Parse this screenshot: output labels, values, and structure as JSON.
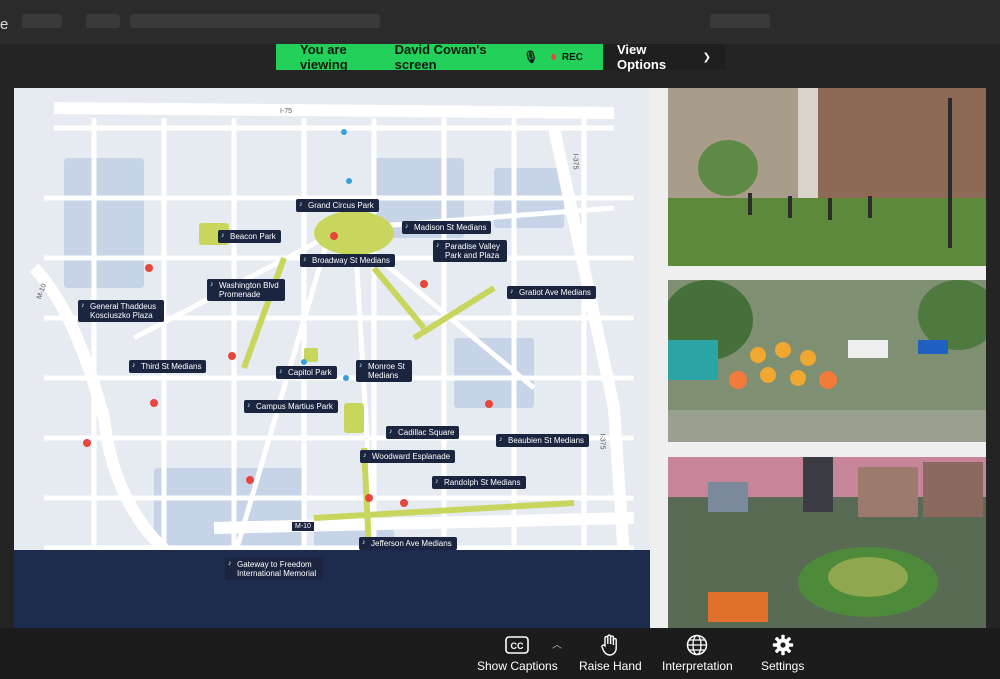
{
  "share_banner": {
    "viewing_prefix": "You are viewing",
    "presenter": "David Cowan's screen",
    "rec_label": "REC",
    "view_options_label": "View Options",
    "rec_color": "#e8453c",
    "accent_green": "#23d15a"
  },
  "topbar": {
    "edge_letter": "e"
  },
  "map": {
    "labels": [
      "Grand Circus Park",
      "Madison St Medians",
      "Beacon Park",
      "Paradise Valley Park and Plaza",
      "Broadway St Medians",
      "Washington Blvd Promenade",
      "Gratiot Ave Medians",
      "General Thaddeus Kosciuszko Plaza",
      "Third St Medians",
      "Capitol Park",
      "Monroe St Medians",
      "Campus Martius Park",
      "Cadillac Square",
      "Beaubien St Medians",
      "Woodward Esplanade",
      "Randolph St Medians",
      "Jefferson Ave Medians",
      "Gateway to Freedom International Memorial"
    ],
    "road_shields": [
      "I-75",
      "I-375",
      "I-375",
      "M-10",
      "M-10"
    ]
  },
  "controls": {
    "captions_label": "Show Captions",
    "raise_hand_label": "Raise Hand",
    "interpretation_label": "Interpretation",
    "settings_label": "Settings",
    "captions_icon": "cc-icon",
    "raise_hand_icon": "hand-icon",
    "interpretation_icon": "globe-icon",
    "settings_icon": "gear-icon"
  }
}
